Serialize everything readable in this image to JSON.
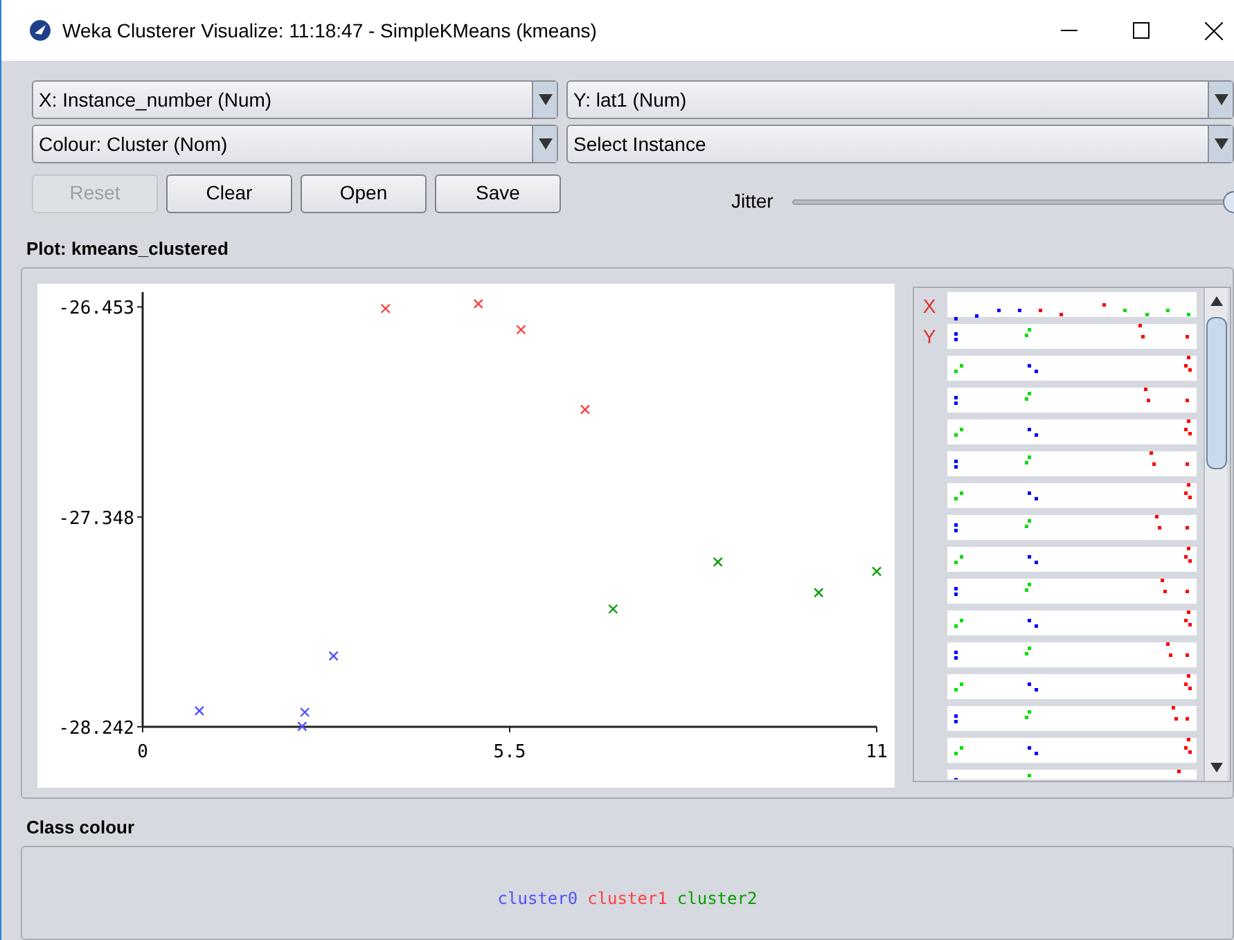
{
  "window": {
    "title": "Weka Clusterer Visualize: 11:18:47 - SimpleKMeans (kmeans)"
  },
  "selectors": [
    {
      "label": "X: Instance_number (Num)"
    },
    {
      "label": "Y: lat1 (Num)"
    },
    {
      "label": "Colour: Cluster (Nom)"
    },
    {
      "label": "Select Instance"
    }
  ],
  "buttons": [
    {
      "label": "Reset",
      "disabled": true
    },
    {
      "label": "Clear",
      "disabled": false
    },
    {
      "label": "Open",
      "disabled": false
    },
    {
      "label": "Save",
      "disabled": false
    }
  ],
  "jitter": {
    "label": "Jitter",
    "level": 1
  },
  "plot": {
    "title": "Plot: kmeans_clustered",
    "chart_data": {
      "type": "scatter",
      "xlim": [
        0,
        11
      ],
      "ylim": [
        -28.242,
        -26.39
      ],
      "xticks": [
        0,
        5.5,
        11
      ],
      "yticks": [
        -28.242,
        -27.348,
        -26.453
      ],
      "series": [
        {
          "name": "cluster0",
          "color": "#5050ff",
          "x": [
            0.85,
            2.43,
            2.39,
            2.86
          ],
          "values": [
            -28.174,
            -28.18,
            -28.24,
            -27.94
          ]
        },
        {
          "name": "cluster1",
          "color": "#ff4040",
          "x": [
            3.64,
            5.03,
            5.67,
            6.63
          ],
          "values": [
            -26.46,
            -26.44,
            -26.55,
            -26.89
          ]
        },
        {
          "name": "cluster2",
          "color": "#00a000",
          "x": [
            7.05,
            8.62,
            10.13,
            11.0
          ],
          "values": [
            -27.74,
            -27.54,
            -27.67,
            -27.58
          ]
        }
      ]
    }
  },
  "matrix": {
    "axis_labels": [
      "X",
      "Y"
    ]
  },
  "class_colour": {
    "title": "Class colour"
  }
}
